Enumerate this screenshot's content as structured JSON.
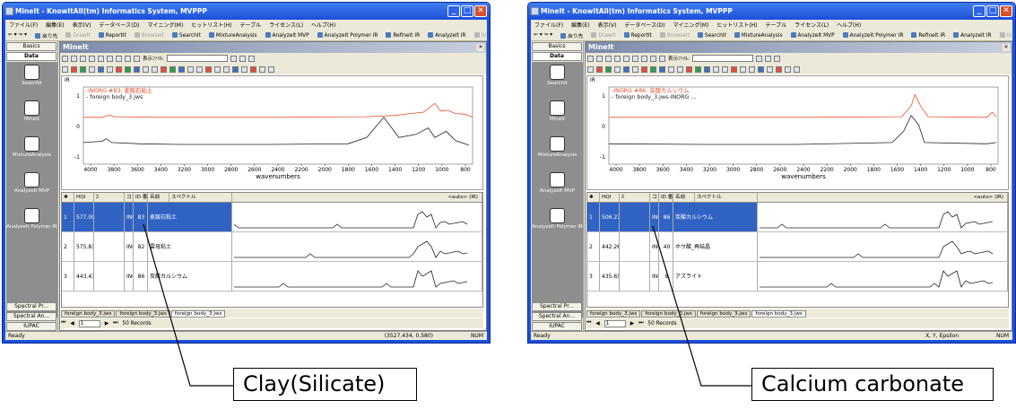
{
  "windows": [
    {
      "title": "MineIt - KnowItAll(tm) Informatics System, MVPPP",
      "menu": [
        "ファイル(F)",
        "編集(E)",
        "表示(V)",
        "データベース(D)",
        "マイニング(M)",
        "ヒットリスト(H)",
        "テーブル",
        "ライセンス(L)",
        "ヘルプ(H)"
      ],
      "toolbar": [
        {
          "label": "戻り先",
          "disabled": false
        },
        {
          "label": "DrawIt",
          "disabled": true
        },
        {
          "label": "ReportIt",
          "disabled": false
        },
        {
          "label": "BrowseIt",
          "disabled": true
        },
        {
          "label": "SearchIt",
          "disabled": false
        },
        {
          "label": "MixtureAnalysis",
          "disabled": false
        },
        {
          "label": "AnalyzeIt MVP",
          "disabled": false
        },
        {
          "label": "AnalyzeIt Polymer IR",
          "disabled": false
        },
        {
          "label": "RefineIt IR",
          "disabled": false
        },
        {
          "label": "AnalyzeIt IR",
          "disabled": false
        },
        {
          "label": "IUPAC",
          "disabled": true
        }
      ],
      "left_tabs": {
        "top": [
          "Basics",
          "Data"
        ],
        "bottom": [
          "Spectral Pr...",
          "Spectral An...",
          "IUPAC"
        ]
      },
      "nav_items": [
        {
          "label": "SearchIt",
          "icon": "search-it-icon"
        },
        {
          "label": "MineIt",
          "icon": "mine-it-icon"
        },
        {
          "label": "MixtureAnalysis",
          "icon": "mixture-analysis-icon"
        },
        {
          "label": "AnalyzeIt MVP",
          "icon": "analyze-mvp-icon"
        },
        {
          "label": "AnalyzeIt Polymer IR",
          "icon": "analyze-polymer-icon"
        }
      ],
      "mdi_title": "MineIt",
      "display_file_label": "表示ﾌｧｲﾙ:",
      "plot_label": "IR",
      "legend": [
        "-INORG #83: 麦飯石粘土",
        "- foreign body_3.jws"
      ],
      "x_axis_label": "wavenumbers",
      "x_ticks": [
        4000,
        3800,
        3600,
        3400,
        3200,
        3000,
        2800,
        2600,
        2400,
        2200,
        2000,
        1800,
        1600,
        1400,
        1200,
        1000,
        800
      ],
      "y_ticks": [
        1,
        0,
        -1
      ],
      "grid_headers": [
        "HQI",
        "ｶ",
        "コレ",
        "ID 番号",
        "名前",
        "スペクトル"
      ],
      "grid_auto": "<auto> (IR)",
      "rows": [
        {
          "n": "1",
          "hqi": "577.00",
          "col": "INORG",
          "id": "83",
          "name": "麦飯石粘土",
          "selected": true
        },
        {
          "n": "2",
          "hqi": "575.83",
          "col": "INORG",
          "id": "82",
          "name": "雲母粘土",
          "selected": false
        },
        {
          "n": "3",
          "hqi": "443.43",
          "col": "INORG",
          "id": "86",
          "name": "炭酸カルシウム",
          "selected": false
        }
      ],
      "sheets": [
        "foreign body_3.jws",
        "foreign body_3.jws",
        "foreign body_3.jws"
      ],
      "record_box": "1",
      "records": "50 Records",
      "status_left": "Ready",
      "status_coord": "(3527.434, 0.580)",
      "status_num": "NUM",
      "callout": "Clay(Silicate)"
    },
    {
      "title": "MineIt - KnowItAll(tm) Informatics System, MVPPP",
      "menu": [
        "ファイル(F)",
        "編集(E)",
        "表示(V)",
        "データベース(D)",
        "マイニング(M)",
        "ヒットリスト(H)",
        "テーブル",
        "ライセンス(L)",
        "ヘルプ(H)"
      ],
      "toolbar": [
        {
          "label": "戻り先",
          "disabled": false
        },
        {
          "label": "DrawIt",
          "disabled": true
        },
        {
          "label": "ReportIt",
          "disabled": false
        },
        {
          "label": "BrowseIt",
          "disabled": true
        },
        {
          "label": "SearchIt",
          "disabled": false
        },
        {
          "label": "MixtureAnalysis",
          "disabled": false
        },
        {
          "label": "AnalyzeIt MVP",
          "disabled": false
        },
        {
          "label": "AnalyzeIt Polymer IR",
          "disabled": false
        },
        {
          "label": "RefineIt IR",
          "disabled": false
        },
        {
          "label": "AnalyzeIt IR",
          "disabled": false
        },
        {
          "label": "IUPAC",
          "disabled": true
        }
      ],
      "left_tabs": {
        "top": [
          "Basics",
          "Data"
        ],
        "bottom": [
          "Spectral Pr...",
          "Spectral An...",
          "IUPAC"
        ]
      },
      "nav_items": [
        {
          "label": "SearchIt",
          "icon": "search-it-icon"
        },
        {
          "label": "MineIt",
          "icon": "mine-it-icon"
        },
        {
          "label": "MixtureAnalysis",
          "icon": "mixture-analysis-icon"
        },
        {
          "label": "AnalyzeIt MVP",
          "icon": "analyze-mvp-icon"
        },
        {
          "label": "AnalyzeIt Polymer IR",
          "icon": "analyze-polymer-icon"
        }
      ],
      "mdi_title": "MineIt",
      "display_file_label": "表示ﾌｧｲﾙ:",
      "plot_label": "IR",
      "legend": [
        "-INORG #86: 炭酸カルシウム",
        "- foreign body_3.jws-INORG ..."
      ],
      "x_axis_label": "wavenumbers",
      "x_ticks": [
        4000,
        3800,
        3600,
        3400,
        3200,
        3000,
        2800,
        2600,
        2400,
        2200,
        2000,
        1800,
        1600,
        1400,
        1200,
        1000,
        800
      ],
      "y_ticks": [
        1,
        0,
        -1
      ],
      "grid_headers": [
        "HQI",
        "ｶ",
        "コレ",
        "ID 番号",
        "名前",
        "スペクトル"
      ],
      "grid_auto": "<auto> (IR)",
      "rows": [
        {
          "n": "1",
          "hqi": "506.27",
          "col": "INORG",
          "id": "86",
          "name": "炭酸カルシウム",
          "selected": true
        },
        {
          "n": "2",
          "hqi": "442.26",
          "col": "INORG",
          "id": "40",
          "name": "ホウ酸_再結晶",
          "selected": false
        },
        {
          "n": "3",
          "hqi": "435.65",
          "col": "INORG",
          "id": "8",
          "name": "アズライト",
          "selected": false
        }
      ],
      "sheets": [
        "foreign body_3.jws",
        "foreign body_3.jws",
        "foreign body_3.jws",
        "foreign body_3.jws"
      ],
      "record_box": "1",
      "records": "50 Records",
      "status_left": "Ready",
      "status_coord": "X, Y, Epsilon",
      "status_num": "NUM",
      "callout": "Calcium carbonate"
    }
  ]
}
